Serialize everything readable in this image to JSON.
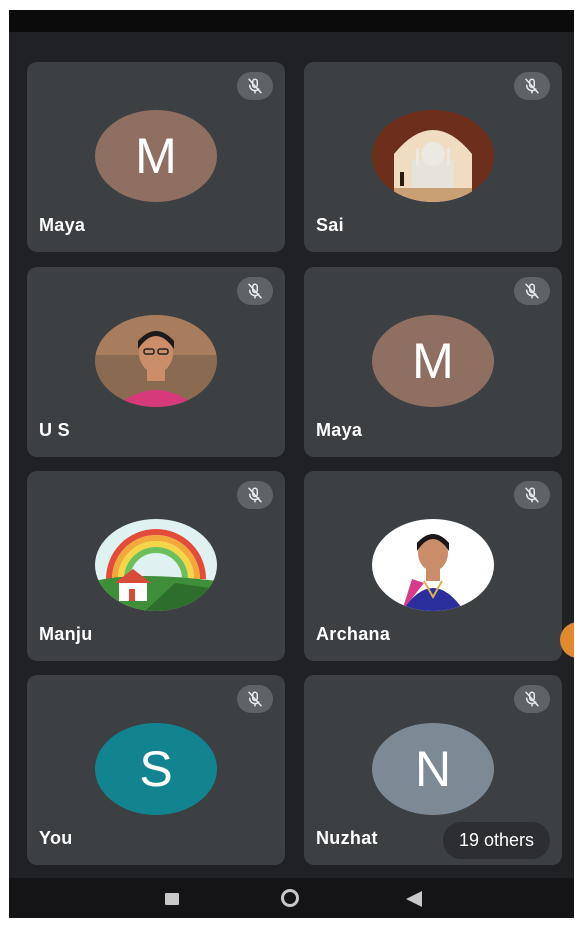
{
  "participants": [
    {
      "name": "Maya",
      "avatar": "letter",
      "initial": "M",
      "color": "#8e6f62"
    },
    {
      "name": "Sai",
      "avatar": "photo-taj-mahal"
    },
    {
      "name": "U S",
      "avatar": "photo-person"
    },
    {
      "name": "Maya",
      "avatar": "letter",
      "initial": "M",
      "color": "#8e6f62"
    },
    {
      "name": "Manju",
      "avatar": "illustration-rainbow-house"
    },
    {
      "name": "Archana",
      "avatar": "photo-person"
    },
    {
      "name": "You",
      "avatar": "letter",
      "initial": "S",
      "color": "#12848f"
    },
    {
      "name": "Nuzhat",
      "avatar": "letter",
      "initial": "N",
      "color": "#7d8a96"
    }
  ],
  "others_label": "19 others",
  "icons": {
    "mic": "mic-off-icon",
    "nav_recent": "square-icon",
    "nav_home": "circle-icon",
    "nav_back": "triangle-back-icon"
  },
  "colors": {
    "background": "#202124",
    "tile": "#3c4043",
    "mic_badge": "#5f6368"
  }
}
